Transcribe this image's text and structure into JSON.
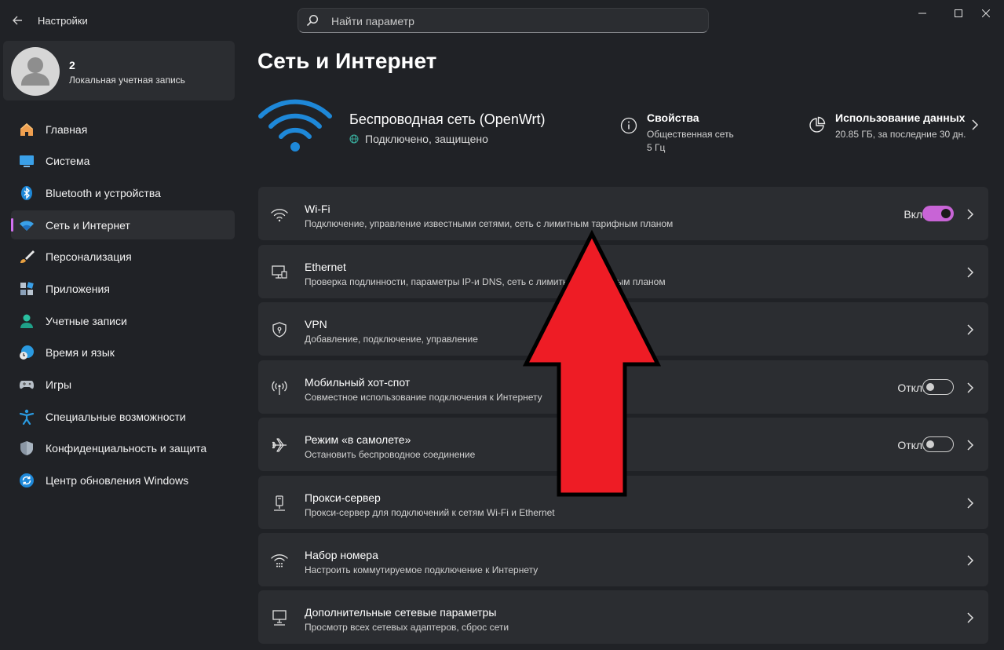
{
  "window": {
    "title": "Настройки",
    "controls": [
      "minimize-icon",
      "maximize-icon",
      "close-icon"
    ]
  },
  "search": {
    "placeholder": "Найти параметр"
  },
  "account": {
    "name": "2",
    "type": "Локальная учетная запись"
  },
  "sidebar": {
    "items": [
      {
        "label": "Главная",
        "icon": "home-icon"
      },
      {
        "label": "Система",
        "icon": "system-icon"
      },
      {
        "label": "Bluetooth и устройства",
        "icon": "bluetooth-icon"
      },
      {
        "label": "Сеть и Интернет",
        "icon": "network-icon",
        "active": true
      },
      {
        "label": "Персонализация",
        "icon": "brush-icon"
      },
      {
        "label": "Приложения",
        "icon": "apps-icon"
      },
      {
        "label": "Учетные записи",
        "icon": "accounts-icon"
      },
      {
        "label": "Время и язык",
        "icon": "globe-clock-icon"
      },
      {
        "label": "Игры",
        "icon": "gamepad-icon"
      },
      {
        "label": "Специальные возможности",
        "icon": "accessibility-icon"
      },
      {
        "label": "Конфиденциальность и защита",
        "icon": "shield-icon"
      },
      {
        "label": "Центр обновления Windows",
        "icon": "update-icon"
      }
    ]
  },
  "main": {
    "title": "Сеть и Интернет",
    "network": {
      "name": "Беспроводная сеть (OpenWrt)",
      "status": "Подключено, защищено"
    },
    "properties": {
      "title": "Свойства",
      "line1": "Общественная сеть",
      "line2": "5 Гц"
    },
    "usage": {
      "title": "Использование данных",
      "subtitle": "20.85 ГБ, за последние 30 дн."
    },
    "cards": [
      {
        "title": "Wi-Fi",
        "subtitle": "Подключение, управление известными сетями, сеть с лимитным тарифным планом",
        "toggle_label": "Вкл.",
        "toggle_on": true
      },
      {
        "title": "Ethernet",
        "subtitle": "Проверка подлинности, параметры IP-и DNS, сеть с лимитным тарифным планом"
      },
      {
        "title": "VPN",
        "subtitle": "Добавление, подключение, управление"
      },
      {
        "title": "Мобильный хот-спот",
        "subtitle": "Совместное использование подключения к Интернету",
        "toggle_label": "Откл.",
        "toggle_on": false
      },
      {
        "title": "Режим «в самолете»",
        "subtitle": "Остановить беспроводное соединение",
        "toggle_label": "Откл.",
        "toggle_on": false
      },
      {
        "title": "Прокси-сервер",
        "subtitle": "Прокси-сервер для подключений к сетям Wi-Fi и Ethernet"
      },
      {
        "title": "Набор номера",
        "subtitle": "Настроить коммутируемое подключение к Интернету"
      },
      {
        "title": "Дополнительные сетевые параметры",
        "subtitle": "Просмотр всех сетевых адаптеров, сброс сети"
      }
    ]
  },
  "colors": {
    "background": "#202226",
    "card": "#2b2d31",
    "accent": "#d270f0",
    "toggle_on": "#c864d6",
    "wifi_blue": "#1e88d8",
    "overlay_arrow": "#ee1c25"
  }
}
